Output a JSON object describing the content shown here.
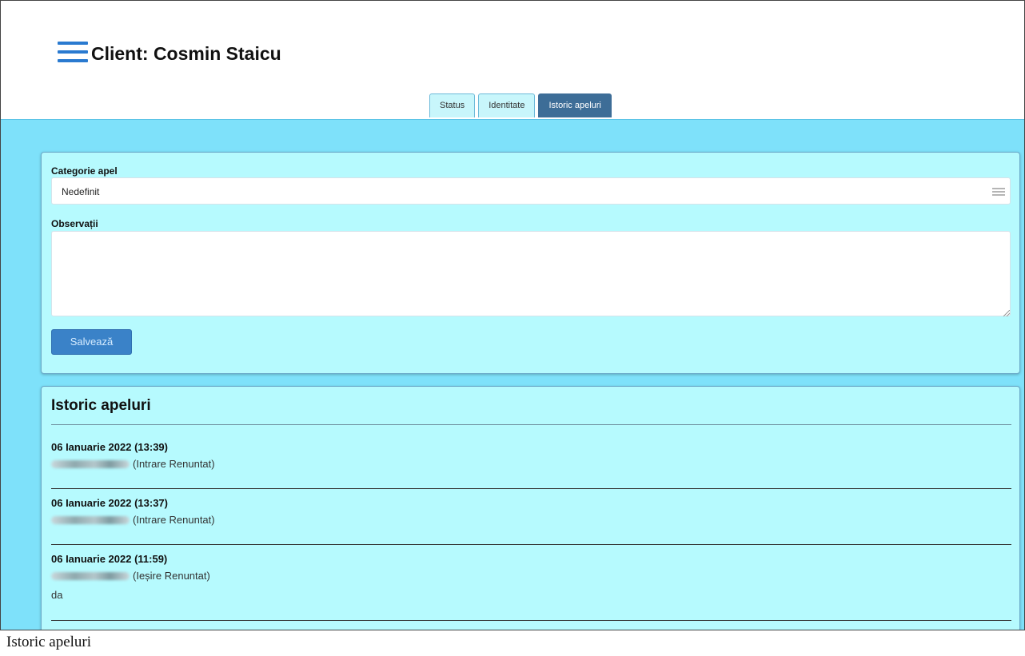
{
  "header": {
    "title": "Client: Cosmin Staicu",
    "menu_icon": "hamburger-menu-icon"
  },
  "tabs": [
    {
      "label": "Status",
      "active": false
    },
    {
      "label": "Identitate",
      "active": false
    },
    {
      "label": "Istoric apeluri",
      "active": true
    }
  ],
  "form": {
    "category_label": "Categorie apel",
    "category_value": "Nedefinit",
    "category_icon": "list-lines-icon",
    "notes_label": "Observații",
    "notes_value": "",
    "save_label": "Salvează"
  },
  "history": {
    "title": "Istoric apeluri",
    "entries": [
      {
        "datetime": "06 Ianuarie 2022 (13:39)",
        "detail": "(Intrare Renuntat)",
        "note": ""
      },
      {
        "datetime": "06 Ianuarie 2022 (13:37)",
        "detail": "(Intrare Renuntat)",
        "note": ""
      },
      {
        "datetime": "06 Ianuarie 2022 (11:59)",
        "detail": "(Ieșire Renuntat)",
        "note": "da"
      }
    ]
  },
  "caption": "Istoric apeluri",
  "colors": {
    "accent": "#2a7ad0",
    "content_bg": "#7ee1fa",
    "panel_bg": "#b6fafe",
    "active_tab": "#3d6d97",
    "save_button": "#3a82c8"
  }
}
